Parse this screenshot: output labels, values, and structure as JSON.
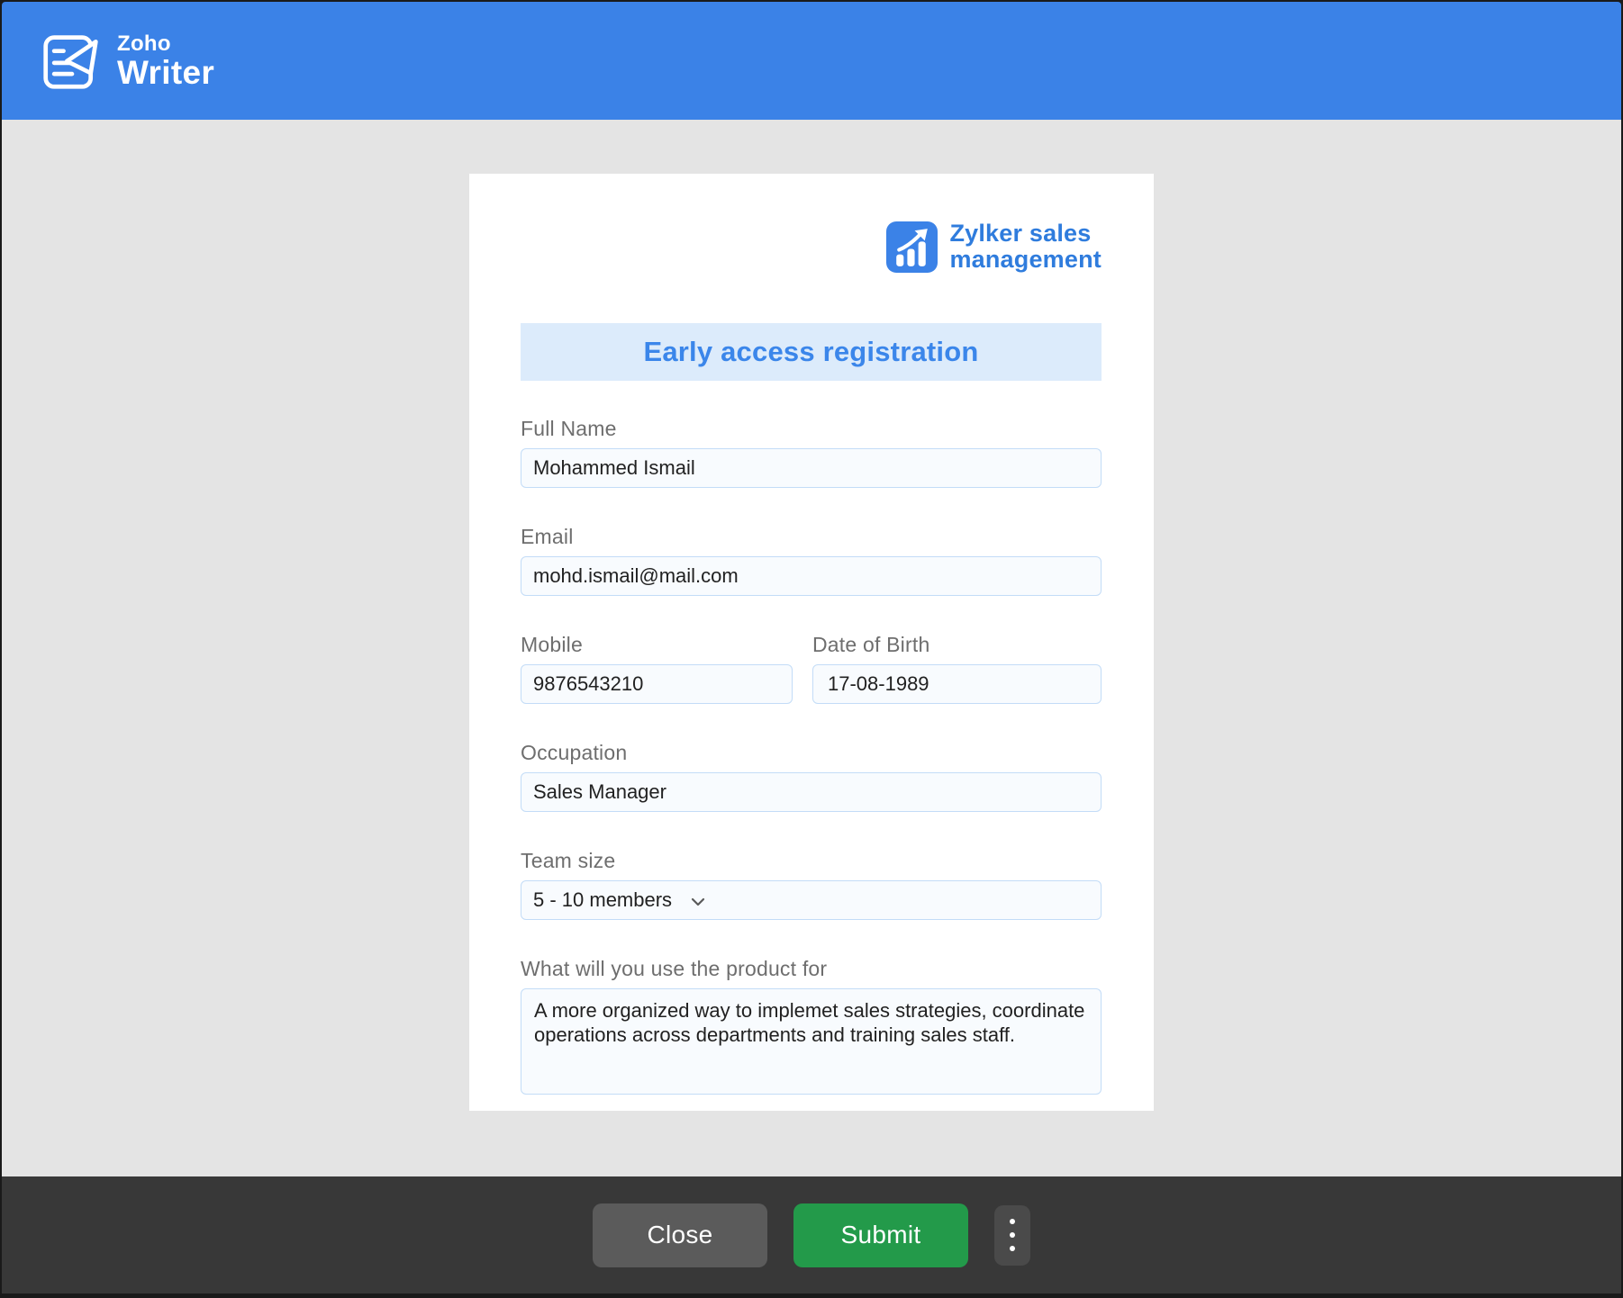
{
  "header": {
    "logo_small": "Zoho",
    "logo_large": "Writer",
    "logo_icon": "writer-document-icon"
  },
  "form": {
    "brand": {
      "icon": "bar-chart-growth-icon",
      "line1": "Zylker sales",
      "line2": "management"
    },
    "title": "Early access registration",
    "fields": {
      "full_name": {
        "label": "Full Name",
        "value": "Mohammed Ismail"
      },
      "email": {
        "label": "Email",
        "value": "mohd.ismail@mail.com"
      },
      "mobile": {
        "label": "Mobile",
        "value": "9876543210"
      },
      "dob": {
        "label": "Date of Birth",
        "value": "17-08-1989"
      },
      "occupation": {
        "label": "Occupation",
        "value": "Sales Manager"
      },
      "team_size": {
        "label": "Team size",
        "value": "5 - 10 members",
        "control": "dropdown"
      },
      "usage": {
        "label": "What will you use the product for",
        "value": "A more organized way to implemet sales strategies, coordinate operations across departments and training sales staff."
      }
    }
  },
  "footer": {
    "close_label": "Close",
    "submit_label": "Submit",
    "more_icon": "kebab-menu-icon"
  },
  "colors": {
    "header_blue": "#3b82e7",
    "accent_blue": "#2f7cdd",
    "banner_bg": "#dcebfb",
    "banner_text": "#3b86ea",
    "body_gray": "#e4e4e4",
    "footer_dark": "#383838",
    "close_gray": "#5b5b5b",
    "submit_green": "#239a4a",
    "input_border": "#c3dcf7",
    "input_bg": "#f8fbfe"
  }
}
